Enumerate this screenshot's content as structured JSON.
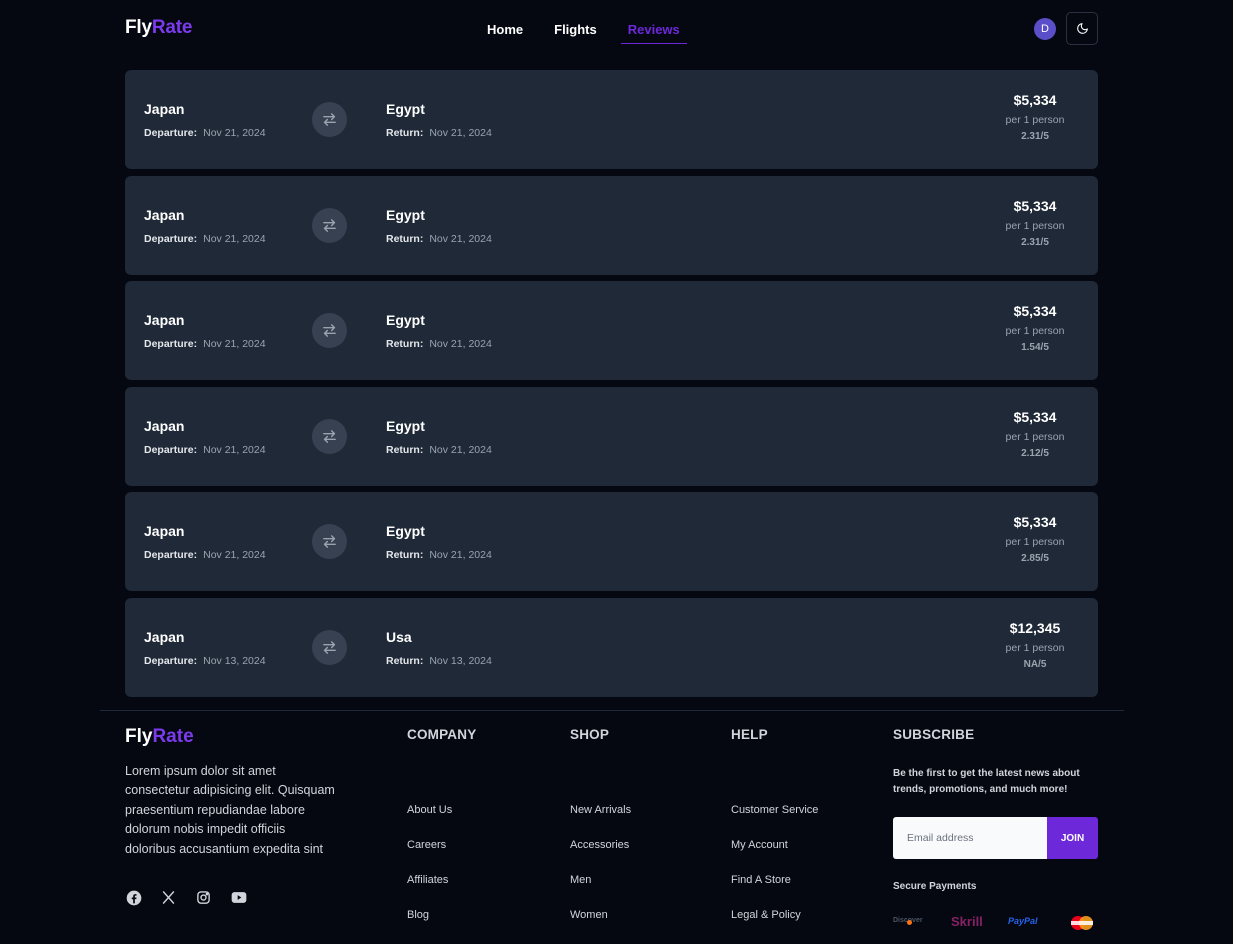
{
  "header": {
    "logo_fly": "Fly",
    "logo_rate": "Rate",
    "nav": [
      "Home",
      "Flights",
      "Reviews"
    ],
    "active_nav": "Reviews",
    "avatar_letter": "D"
  },
  "colors": {
    "accent": "#6d28d9",
    "card_bg": "#1f2937",
    "page_bg": "#050811"
  },
  "flights": [
    {
      "from": "Japan",
      "to": "Egypt",
      "departure_label": "Departure:",
      "departure": "Nov 21, 2024",
      "return_label": "Return:",
      "return": "Nov 21, 2024",
      "price": "$5,334",
      "per": "per 1 person",
      "rating": "2.31/5"
    },
    {
      "from": "Japan",
      "to": "Egypt",
      "departure_label": "Departure:",
      "departure": "Nov 21, 2024",
      "return_label": "Return:",
      "return": "Nov 21, 2024",
      "price": "$5,334",
      "per": "per 1 person",
      "rating": "2.31/5"
    },
    {
      "from": "Japan",
      "to": "Egypt",
      "departure_label": "Departure:",
      "departure": "Nov 21, 2024",
      "return_label": "Return:",
      "return": "Nov 21, 2024",
      "price": "$5,334",
      "per": "per 1 person",
      "rating": "1.54/5"
    },
    {
      "from": "Japan",
      "to": "Egypt",
      "departure_label": "Departure:",
      "departure": "Nov 21, 2024",
      "return_label": "Return:",
      "return": "Nov 21, 2024",
      "price": "$5,334",
      "per": "per 1 person",
      "rating": "2.12/5"
    },
    {
      "from": "Japan",
      "to": "Egypt",
      "departure_label": "Departure:",
      "departure": "Nov 21, 2024",
      "return_label": "Return:",
      "return": "Nov 21, 2024",
      "price": "$5,334",
      "per": "per 1 person",
      "rating": "2.85/5"
    },
    {
      "from": "Japan",
      "to": "Usa",
      "departure_label": "Departure:",
      "departure": "Nov 13, 2024",
      "return_label": "Return:",
      "return": "Nov 13, 2024",
      "price": "$12,345",
      "per": "per 1 person",
      "rating": "NA/5"
    }
  ],
  "footer": {
    "logo_fly": "Fly",
    "logo_rate": "Rate",
    "description": "Lorem ipsum dolor sit amet consectetur adipisicing elit. Quisquam praesentium repudiandae labore dolorum nobis impedit officiis doloribus accusantium expedita sint",
    "social_icons": [
      "facebook-icon",
      "x-icon",
      "instagram-icon",
      "youtube-icon"
    ],
    "columns": [
      {
        "title": "COMPANY",
        "links": [
          "About Us",
          "Careers",
          "Affiliates",
          "Blog"
        ]
      },
      {
        "title": "SHOP",
        "links": [
          "New Arrivals",
          "Accessories",
          "Men",
          "Women"
        ]
      },
      {
        "title": "HELP",
        "links": [
          "Customer Service",
          "My Account",
          "Find A Store",
          "Legal & Policy"
        ]
      }
    ],
    "subscribe": {
      "title": "SUBSCRIBE",
      "text": "Be the first to get the latest news about trends, promotions, and much more!",
      "placeholder": "Email address",
      "button": "JOIN",
      "secure_payments": "Secure Payments",
      "payment_logos": [
        "Discover",
        "Skrill",
        "PayPal",
        "Mastercard"
      ]
    }
  }
}
